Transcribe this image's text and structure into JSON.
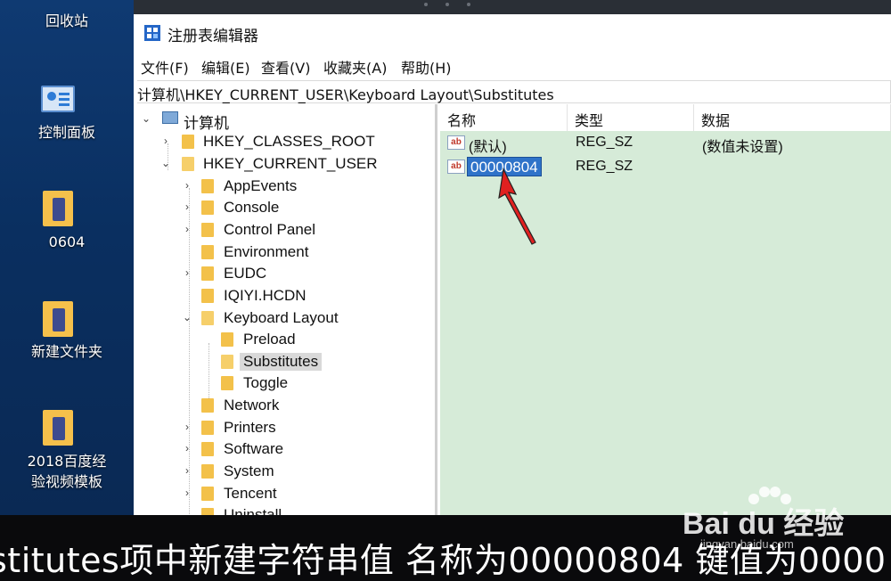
{
  "desktop": {
    "items": [
      {
        "label": "回收站"
      },
      {
        "label": "控制面板"
      },
      {
        "label": "0604"
      },
      {
        "label": "新建文件夹"
      },
      {
        "label": "2018百度经"
      },
      {
        "label": "验视频模板"
      }
    ]
  },
  "window": {
    "title": "注册表编辑器",
    "menu": [
      "文件(F)",
      "编辑(E)",
      "查看(V)",
      "收藏夹(A)",
      "帮助(H)"
    ],
    "address": "计算机\\HKEY_CURRENT_USER\\Keyboard Layout\\Substitutes"
  },
  "tree": {
    "root": "计算机",
    "items": [
      {
        "label": "HKEY_CLASSES_ROOT",
        "state": "collapsed"
      },
      {
        "label": "HKEY_CURRENT_USER",
        "state": "expanded"
      },
      {
        "label": "AppEvents",
        "state": "collapsed"
      },
      {
        "label": "Console",
        "state": "collapsed"
      },
      {
        "label": "Control Panel",
        "state": "collapsed"
      },
      {
        "label": "Environment",
        "state": "leaf"
      },
      {
        "label": "EUDC",
        "state": "collapsed"
      },
      {
        "label": "IQIYI.HCDN",
        "state": "leaf"
      },
      {
        "label": "Keyboard Layout",
        "state": "expanded"
      },
      {
        "label": "Preload",
        "state": "leaf"
      },
      {
        "label": "Substitutes",
        "state": "selected"
      },
      {
        "label": "Toggle",
        "state": "leaf"
      },
      {
        "label": "Network",
        "state": "leaf"
      },
      {
        "label": "Printers",
        "state": "collapsed"
      },
      {
        "label": "Software",
        "state": "collapsed"
      },
      {
        "label": "System",
        "state": "collapsed"
      },
      {
        "label": "Tencent",
        "state": "collapsed"
      },
      {
        "label": "Uninstall",
        "state": "leaf"
      }
    ]
  },
  "values": {
    "columns": [
      "名称",
      "类型",
      "数据"
    ],
    "rows": [
      {
        "name": "(默认)",
        "type": "REG_SZ",
        "data": "(数值未设置)"
      },
      {
        "name": "00000804",
        "type": "REG_SZ",
        "data": ""
      }
    ],
    "icon_text": "ab"
  },
  "subtitle": "stitutes项中新建字符串值 名称为00000804 键值为0000",
  "watermark": {
    "brand": "Bai du 经验",
    "url": "jingyan.baidu.com"
  },
  "colors": {
    "values_bg": "#d6ebd8",
    "selection": "#2f73c9",
    "arrow": "#e02020"
  }
}
